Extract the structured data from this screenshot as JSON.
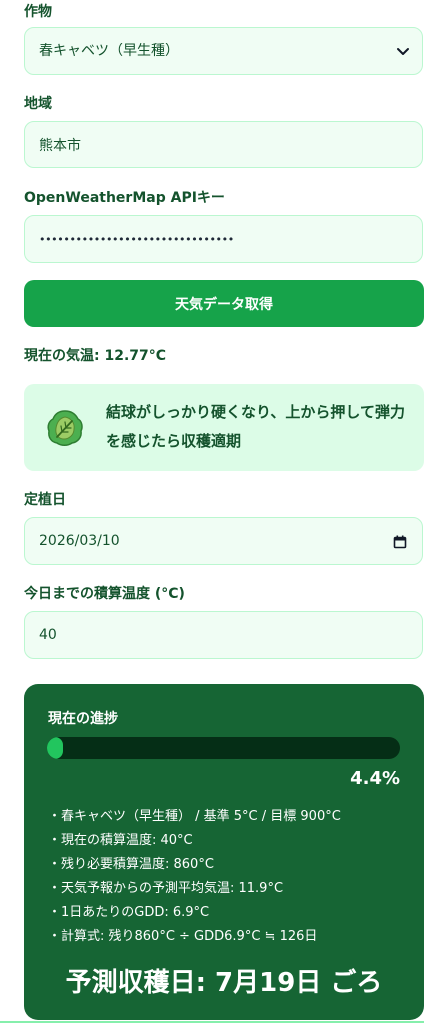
{
  "form": {
    "crop_label": "作物",
    "crop_selected": "春キャベツ（早生種）",
    "region_label": "地域",
    "region_value": "熊本市",
    "api_label": "OpenWeatherMap APIキー",
    "api_value_masked": "••••••••••••••••••••••••••••••••",
    "fetch_button": "天気データ取得",
    "current_temp": "現在の気温: 12.77°C",
    "tip": "結球がしっかり硬くなり、上から押して弾力を感じたら収穫適期",
    "planting_label": "定植日",
    "planting_date": "2026/03/10",
    "gdd_label": "今日までの積算温度 (°C)",
    "gdd_value": "40"
  },
  "progress": {
    "title": "現在の進捗",
    "percent": 4.4,
    "percent_label": "4.4%",
    "details": [
      "・春キャベツ（早生種） / 基準 5°C / 目標 900°C",
      "・現在の積算温度: 40°C",
      "・残り必要積算温度: 860°C",
      "・天気予報からの予測平均気温: 11.9°C",
      "・1日あたりのGDD: 6.9°C",
      "・計算式: 残り860°C ÷ GDD6.9°C ≒ 126日"
    ],
    "prediction": "予測収穫日: 7月19日 ごろ"
  },
  "icons": {
    "select_arrow": "chevron-down-icon",
    "tip_icon": "cabbage-icon",
    "date_picker": "calendar-icon"
  },
  "colors": {
    "accent": "#16a34a",
    "field_bg": "#f0fdf4",
    "field_border": "#bbf7d0",
    "tip_bg": "#dcfce7",
    "card_bg": "#166534",
    "progress_track": "#052e16",
    "progress_fill": "#22c55e",
    "label_text": "#14532d"
  }
}
